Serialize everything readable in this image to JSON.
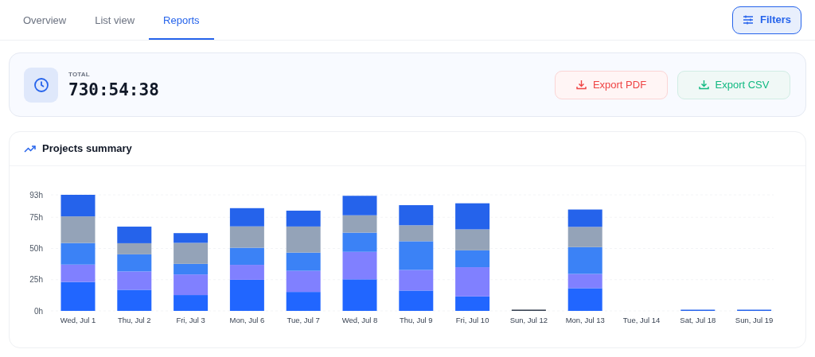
{
  "tabs": [
    {
      "label": "Overview",
      "selected": false
    },
    {
      "label": "List view",
      "selected": false
    },
    {
      "label": "Reports",
      "selected": true
    }
  ],
  "filters_button": {
    "label": "Filters"
  },
  "total": {
    "label": "TOTAL",
    "value": "730:54:38"
  },
  "export_buttons": [
    {
      "kind": "pdf",
      "label": "Export PDF"
    },
    {
      "kind": "csv",
      "label": "Export CSV"
    }
  ],
  "projects_summary": {
    "title": "Projects summary",
    "chart_data": {
      "type": "bar",
      "stacked": true,
      "categories": [
        "Wed, Jul 1",
        "Thu, Jul 2",
        "Fri, Jul 3",
        "Mon, Jul 6",
        "Tue, Jul 7",
        "Wed, Jul 8",
        "Thu, Jul 9",
        "Fri, Jul 10",
        "Sun, Jul 12",
        "Mon, Jul 13",
        "Tue, Jul 14",
        "Sat, Jul 18",
        "Sun, Jul 19"
      ],
      "series": [
        {
          "color": "#2166ff",
          "values": [
            23.2,
            16.9,
            12.7,
            24.9,
            15.2,
            25.3,
            16.3,
            11.6,
            null,
            18.2,
            null,
            null,
            null
          ]
        },
        {
          "color": "#8080ff",
          "values": [
            13.9,
            14.7,
            16.5,
            12,
            16.9,
            22,
            16.5,
            23.4,
            null,
            11.4,
            null,
            null,
            null
          ]
        },
        {
          "color": "#3b82f6",
          "values": [
            17.3,
            13.7,
            8.5,
            13.7,
            14.6,
            15.4,
            23,
            13.5,
            null,
            21.5,
            null,
            null,
            null
          ]
        },
        {
          "color": "#94a3b8",
          "values": [
            21.3,
            8.9,
            16.8,
            17.1,
            20.9,
            13.9,
            12.8,
            16.8,
            null,
            16.2,
            null,
            null,
            null
          ]
        },
        {
          "color": "#2563eb",
          "values": [
            17.3,
            13.3,
            7.8,
            14.6,
            12.7,
            15.6,
            16.1,
            20.9,
            null,
            13.9,
            null,
            0.8,
            0.8
          ]
        },
        {
          "color": "#374151",
          "values": [
            null,
            null,
            null,
            null,
            null,
            null,
            null,
            null,
            1,
            null,
            null,
            null,
            null
          ]
        }
      ],
      "grid": true,
      "ylim": [
        0,
        93
      ],
      "yticks": [
        {
          "value": 0,
          "label": "0h"
        },
        {
          "value": 25,
          "label": "25h"
        },
        {
          "value": 50,
          "label": "50h"
        },
        {
          "value": 75,
          "label": "75h"
        },
        {
          "value": 93,
          "label": "93h"
        }
      ]
    }
  }
}
